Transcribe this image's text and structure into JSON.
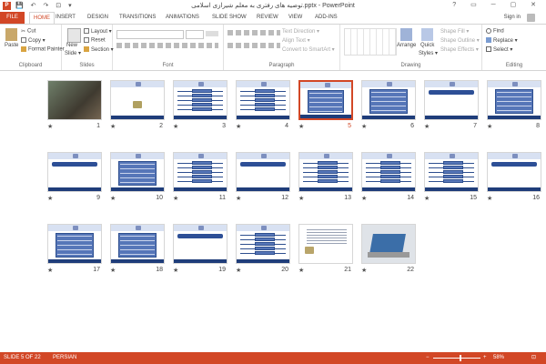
{
  "window": {
    "title": "توصیه های رفتری به معلم شیرازی اسلامی.pptx - PowerPoint",
    "app_icon": "P",
    "qat": "💾 ↶ ↷ ⊡ ▾",
    "controls": "? ▭ ─ ▢ ✕"
  },
  "tabs": {
    "file": "FILE",
    "items": [
      "HOME",
      "INSERT",
      "DESIGN",
      "TRANSITIONS",
      "ANIMATIONS",
      "SLIDE SHOW",
      "REVIEW",
      "VIEW",
      "ADD-INS"
    ],
    "active": "HOME",
    "signin": "Sign in"
  },
  "ribbon": {
    "clipboard": {
      "label": "Clipboard",
      "paste": "Paste",
      "cut": "Cut",
      "copy": "Copy ▾",
      "format_painter": "Format Painter"
    },
    "slides": {
      "label": "Slides",
      "new_slide_line1": "New",
      "new_slide_line2": "Slide ▾",
      "layout": "Layout ▾",
      "reset": "Reset",
      "section": "Section ▾"
    },
    "font": {
      "label": "Font"
    },
    "paragraph": {
      "label": "Paragraph",
      "text_direction": "Text Direction ▾",
      "align_text": "Align Text ▾",
      "convert_smartart": "Convert to SmartArt ▾"
    },
    "drawing": {
      "label": "Drawing",
      "arrange": "Arrange",
      "quick_styles_line1": "Quick",
      "quick_styles_line2": "Styles ▾",
      "shape_fill": "Shape Fill ▾",
      "shape_outline": "Shape Outline ▾",
      "shape_effects": "Shape Effects ▾"
    },
    "editing": {
      "label": "Editing",
      "find": "Find",
      "replace": "Replace ▾",
      "select": "Select ▾"
    }
  },
  "slides": {
    "row1": [
      {
        "num": "8",
        "type": "panel"
      },
      {
        "num": "7",
        "type": "banner"
      },
      {
        "num": "6",
        "type": "panel"
      },
      {
        "num": "5",
        "type": "panel",
        "selected": true
      },
      {
        "num": "4",
        "type": "lines"
      },
      {
        "num": "3",
        "type": "lines"
      },
      {
        "num": "2",
        "type": "logo"
      },
      {
        "num": "1",
        "type": "photo"
      }
    ],
    "row2": [
      {
        "num": "16",
        "type": "banner"
      },
      {
        "num": "15",
        "type": "lines"
      },
      {
        "num": "14",
        "type": "lines"
      },
      {
        "num": "13",
        "type": "lines"
      },
      {
        "num": "12",
        "type": "banner"
      },
      {
        "num": "11",
        "type": "lines"
      },
      {
        "num": "10",
        "type": "panel"
      },
      {
        "num": "9",
        "type": "banner"
      }
    ],
    "row3": [
      {
        "num": "22",
        "type": "laptop"
      },
      {
        "num": "21",
        "type": "doc"
      },
      {
        "num": "20",
        "type": "lines"
      },
      {
        "num": "19",
        "type": "banner"
      },
      {
        "num": "18",
        "type": "panel"
      },
      {
        "num": "17",
        "type": "panel"
      }
    ],
    "star": "★"
  },
  "status": {
    "slide_counter": "SLIDE 5 OF 22",
    "language": "PERSIAN",
    "zoom_minus": "−",
    "zoom_plus": "+",
    "zoom": "58%",
    "zoom_fraction": 0.58
  }
}
